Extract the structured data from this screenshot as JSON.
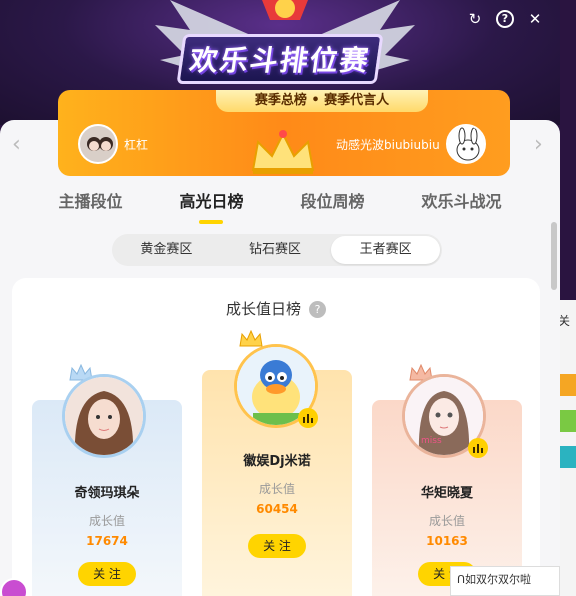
{
  "banner": {
    "title": "欢乐斗排位赛",
    "controls": {
      "refresh": "↻",
      "help": "?",
      "close": "✕"
    }
  },
  "season": {
    "pill": "赛季总榜 • 赛季代言人",
    "left_user": "杠杠",
    "right_user": "动感光波biubiubiu"
  },
  "tabs": [
    {
      "label": "主播段位",
      "active": false
    },
    {
      "label": "高光日榜",
      "active": true
    },
    {
      "label": "段位周榜",
      "active": false
    },
    {
      "label": "欢乐斗战况",
      "active": false
    }
  ],
  "zones": [
    {
      "label": "黄金赛区",
      "active": false
    },
    {
      "label": "钻石赛区",
      "active": false
    },
    {
      "label": "王者赛区",
      "active": true
    }
  ],
  "ranking": {
    "title": "成长值日榜",
    "help": "?",
    "value_label": "成长值",
    "follow_label": "关 注",
    "entries": [
      {
        "rank": 2,
        "name": "奇领玛琪朵",
        "value": "17674"
      },
      {
        "rank": 1,
        "name": "徽娱Dj米诺",
        "value": "60454"
      },
      {
        "rank": 3,
        "name": "华矩晓夏",
        "value": "10163"
      }
    ]
  },
  "background": {
    "right_text": "关",
    "bottom_text": "ᑎ如双尔双尔啦"
  },
  "colors": {
    "accent": "#ffd400",
    "value": "#ff8a00",
    "season": "#ff8a18"
  }
}
